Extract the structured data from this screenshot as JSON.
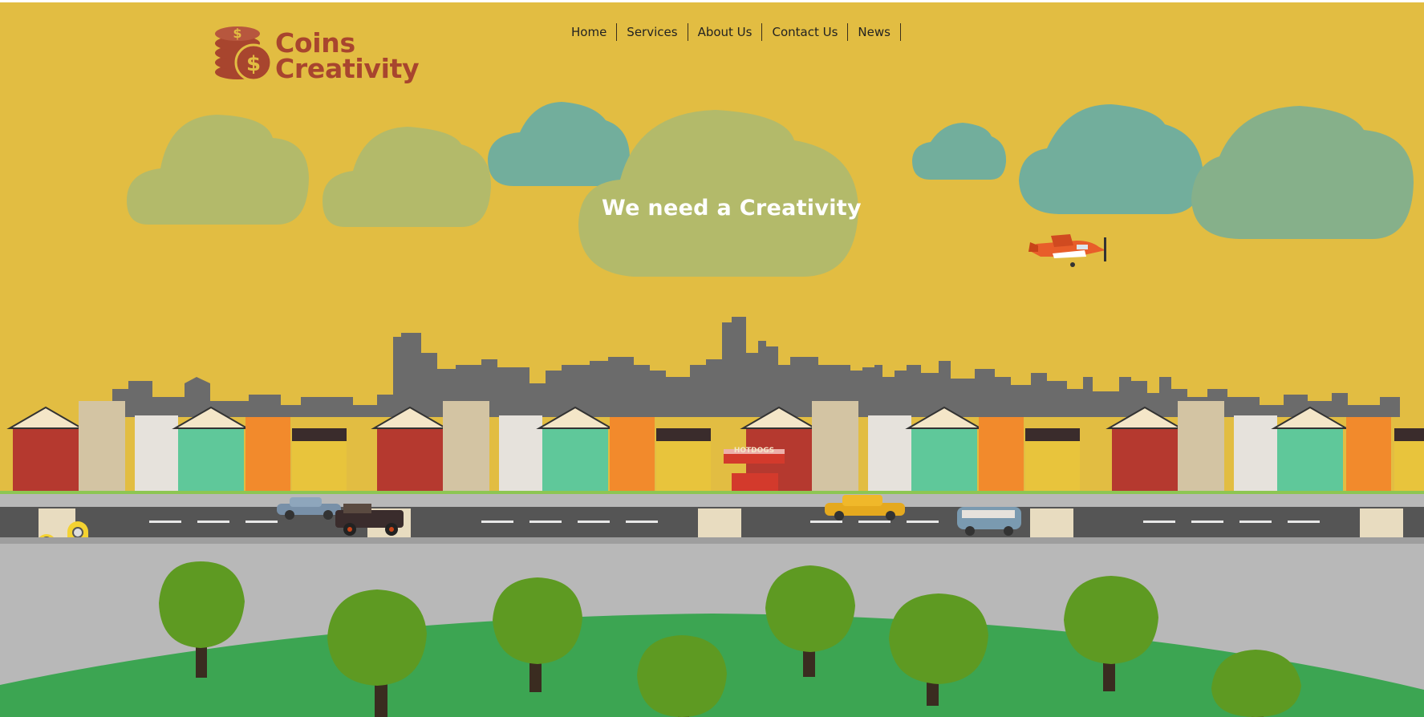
{
  "site": {
    "brand_line1": "Coins",
    "brand_line2": "Creativity"
  },
  "nav": {
    "items": [
      {
        "label": "Home"
      },
      {
        "label": "Services"
      },
      {
        "label": "About Us"
      },
      {
        "label": "Contact Us"
      },
      {
        "label": "News"
      }
    ]
  },
  "hero": {
    "title": "We need a Creativity",
    "hotdog_sign": "HOTDOGS"
  },
  "colors": {
    "sky": "#e2bd42",
    "brand": "#a8452e",
    "cloud_green": "#b3ba6a",
    "cloud_teal": "#72ae9c",
    "skyline": "#6b6b6b",
    "road": "#555555",
    "sidewalk": "#b8b8b8",
    "hill": "#3ca552",
    "tree": "#5e9a22"
  }
}
